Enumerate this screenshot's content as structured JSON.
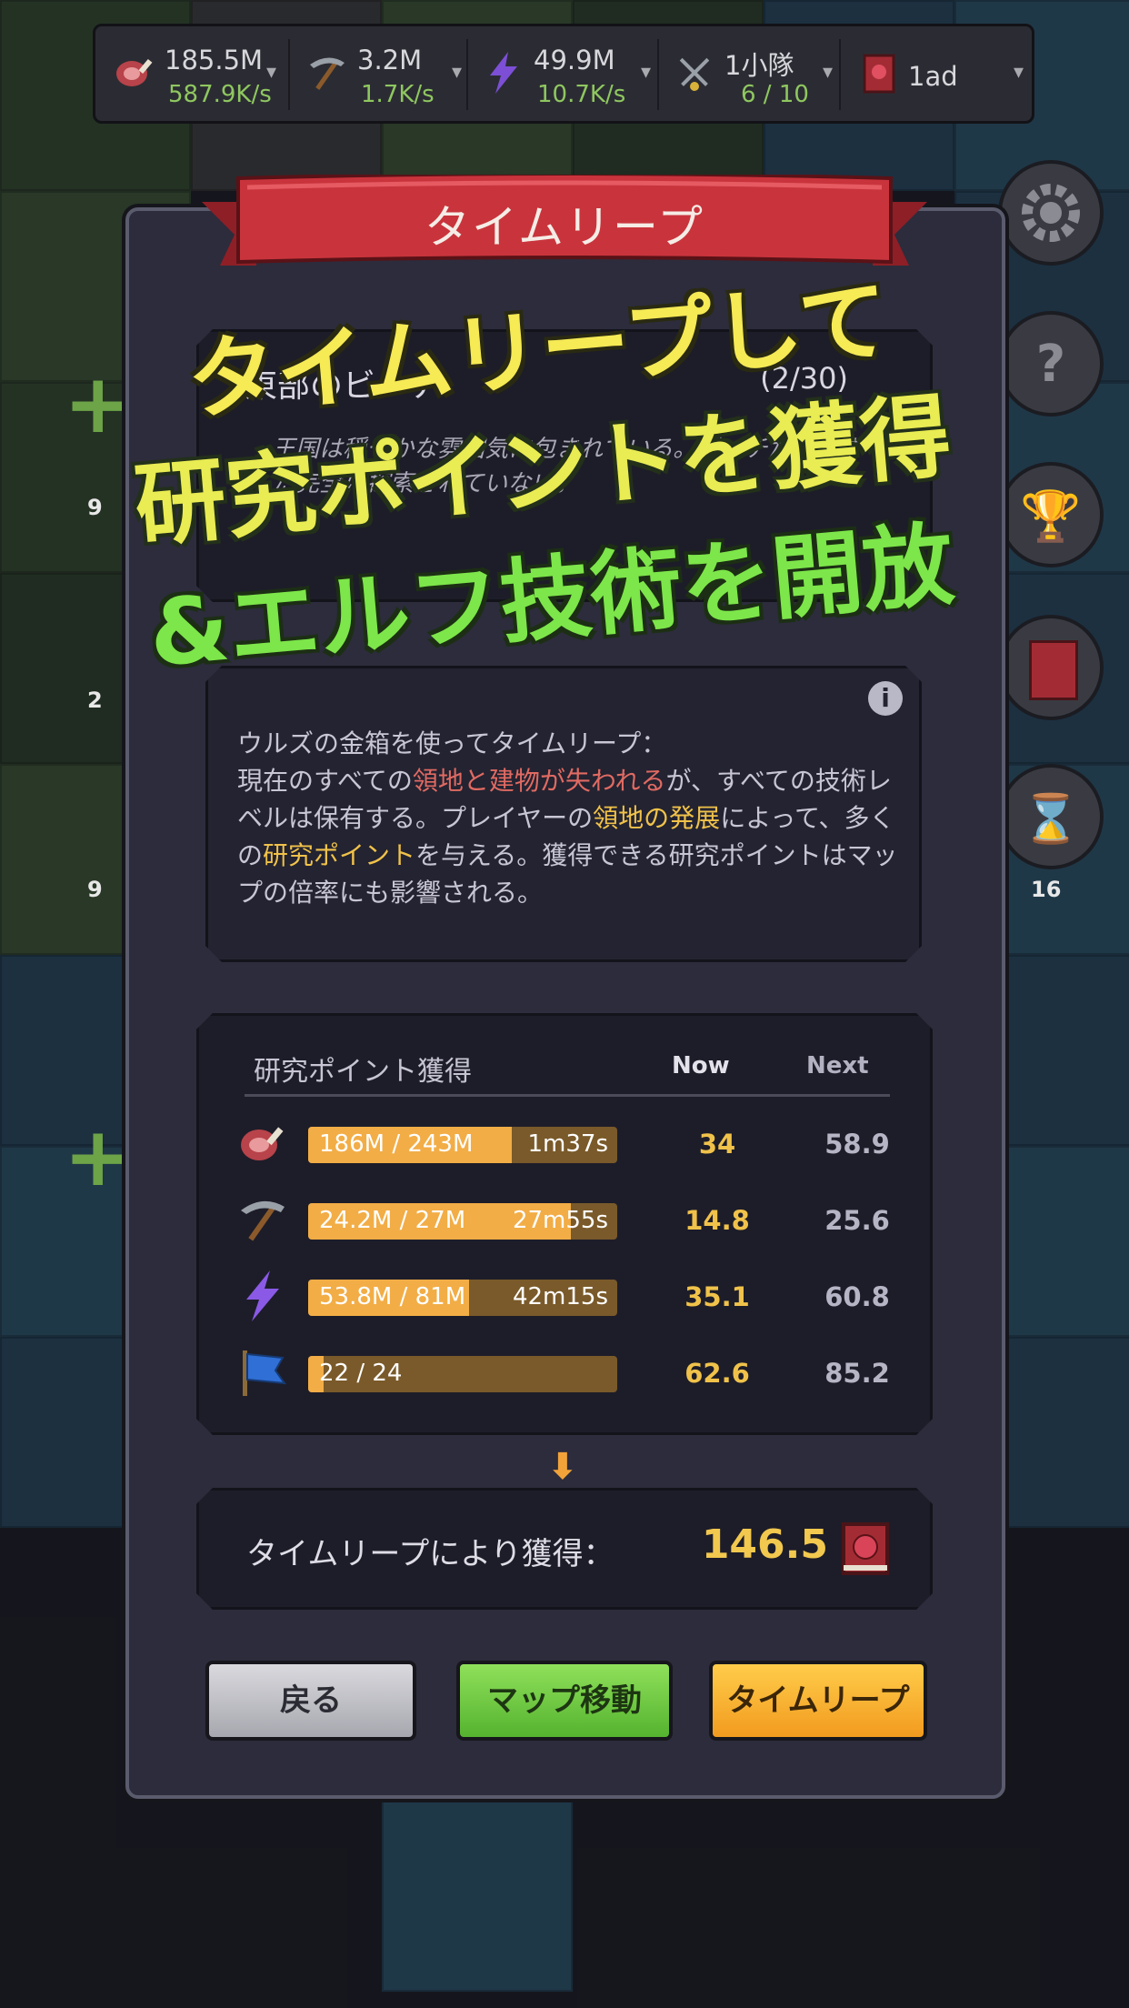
{
  "topbar": {
    "food": {
      "value": "185.5M",
      "rate": "587.9K/s",
      "icon": "meat-icon"
    },
    "wood": {
      "value": "3.2M",
      "rate": "1.7K/s",
      "icon": "pickaxe-icon"
    },
    "energy": {
      "value": "49.9M",
      "rate": "10.7K/s",
      "icon": "lightning-icon"
    },
    "squad": {
      "value": "1小隊",
      "rate": "6 / 10",
      "icon": "crossed-swords-icon"
    },
    "ad": {
      "value": "1ad",
      "icon": "book-icon"
    },
    "caret": "▾"
  },
  "side_badges": {
    "a": "9",
    "b": "2",
    "c": "9",
    "d": "16"
  },
  "dialog": {
    "title": "タイムリープ",
    "area": {
      "title": "東部のビーチ",
      "count": "(2/30)",
      "desc": "王国は穏やかな雰囲気に包まれている。ビーチだけはまだ完全に探索されていない。"
    },
    "info": {
      "line1": "ウルズの金箱を使ってタイムリープ：",
      "p1": "現在のすべての",
      "hl1": "領地と建物が失われる",
      "p2": "が、すべての技術レベルは保有する。プレイヤーの",
      "hl2": "領地の発展",
      "p3": "によって、多くの",
      "hl3": "研究ポイント",
      "p4": "を与える。獲得できる研究ポイントはマップの倍率にも影響される。"
    },
    "research": {
      "header": {
        "title": "研究ポイント獲得",
        "now": "Now",
        "next": "Next"
      },
      "rows": [
        {
          "icon": "meat-icon",
          "progress": "186M / 243M",
          "timer": "1m37s",
          "fill": 0.66,
          "now": "34",
          "next": "58.9"
        },
        {
          "icon": "pickaxe-icon",
          "progress": "24.2M / 27M",
          "timer": "27m55s",
          "fill": 0.85,
          "now": "14.8",
          "next": "25.6"
        },
        {
          "icon": "lightning-icon",
          "progress": "53.8M / 81M",
          "timer": "42m15s",
          "fill": 0.52,
          "now": "35.1",
          "next": "60.8"
        },
        {
          "icon": "flag-icon",
          "progress": "22 / 24",
          "timer": "",
          "fill": 0.05,
          "now": "62.6",
          "next": "85.2"
        }
      ]
    },
    "arrow": "⬇",
    "result": {
      "label": "タイムリープにより獲得：",
      "value": "146.5",
      "icon": "research-book-icon"
    },
    "buttons": {
      "back": "戻る",
      "map": "マップ移動",
      "leap": "タイムリープ"
    }
  },
  "promo": {
    "line1": "タイムリープして",
    "line2": "研究ポイントを獲得",
    "line3": "&エルフ技術を開放"
  },
  "colors": {
    "accent_yellow": "#f2c84e",
    "accent_green": "#7de64a",
    "ribbon_red": "#c9343c",
    "highlight_red": "#e06a62"
  }
}
